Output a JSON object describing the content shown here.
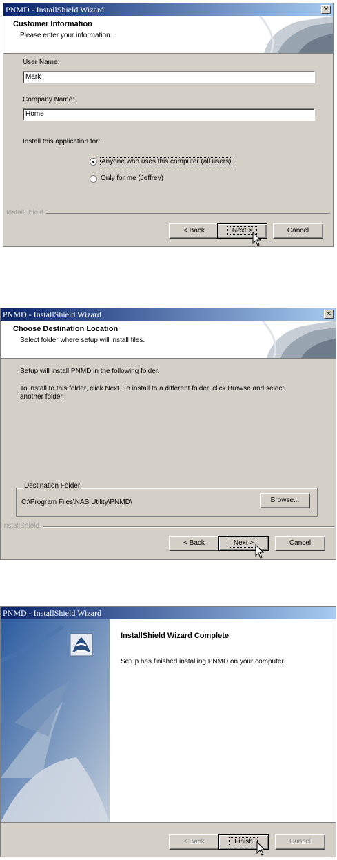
{
  "dialog1": {
    "title": "PNMD - InstallShield Wizard",
    "header_title": "Customer Information",
    "header_subtitle": "Please enter your information.",
    "user_name_label": "User Name:",
    "user_name_value": "Mark",
    "company_name_label": "Company Name:",
    "company_name_value": "Home",
    "install_for_label": "Install this application for:",
    "option_all_users": "Anyone who uses this computer (all users)",
    "option_only_me": "Only for me (Jeffrey)",
    "brand": "InstallShield",
    "back_button": "< Back",
    "next_button": "Next >",
    "cancel_button": "Cancel"
  },
  "dialog2": {
    "title": "PNMD - InstallShield Wizard",
    "header_title": "Choose Destination Location",
    "header_subtitle": "Select folder where setup will install files.",
    "line1": "Setup will install PNMD in the following folder.",
    "line2": "To install to this folder, click Next. To install to a different folder, click Browse and select another folder.",
    "group_label": "Destination Folder",
    "folder_path": "C:\\Program Files\\NAS Utility\\PNMD\\",
    "browse_button": "Browse...",
    "brand": "InstallShield",
    "back_button": "< Back",
    "next_button": "Next >",
    "cancel_button": "Cancel"
  },
  "dialog3": {
    "title": "PNMD - InstallShield Wizard",
    "heading": "InstallShield Wizard Complete",
    "message": "Setup has finished installing PNMD on your computer.",
    "back_button": "< Back",
    "finish_button": "Finish",
    "cancel_button": "Cancel"
  }
}
